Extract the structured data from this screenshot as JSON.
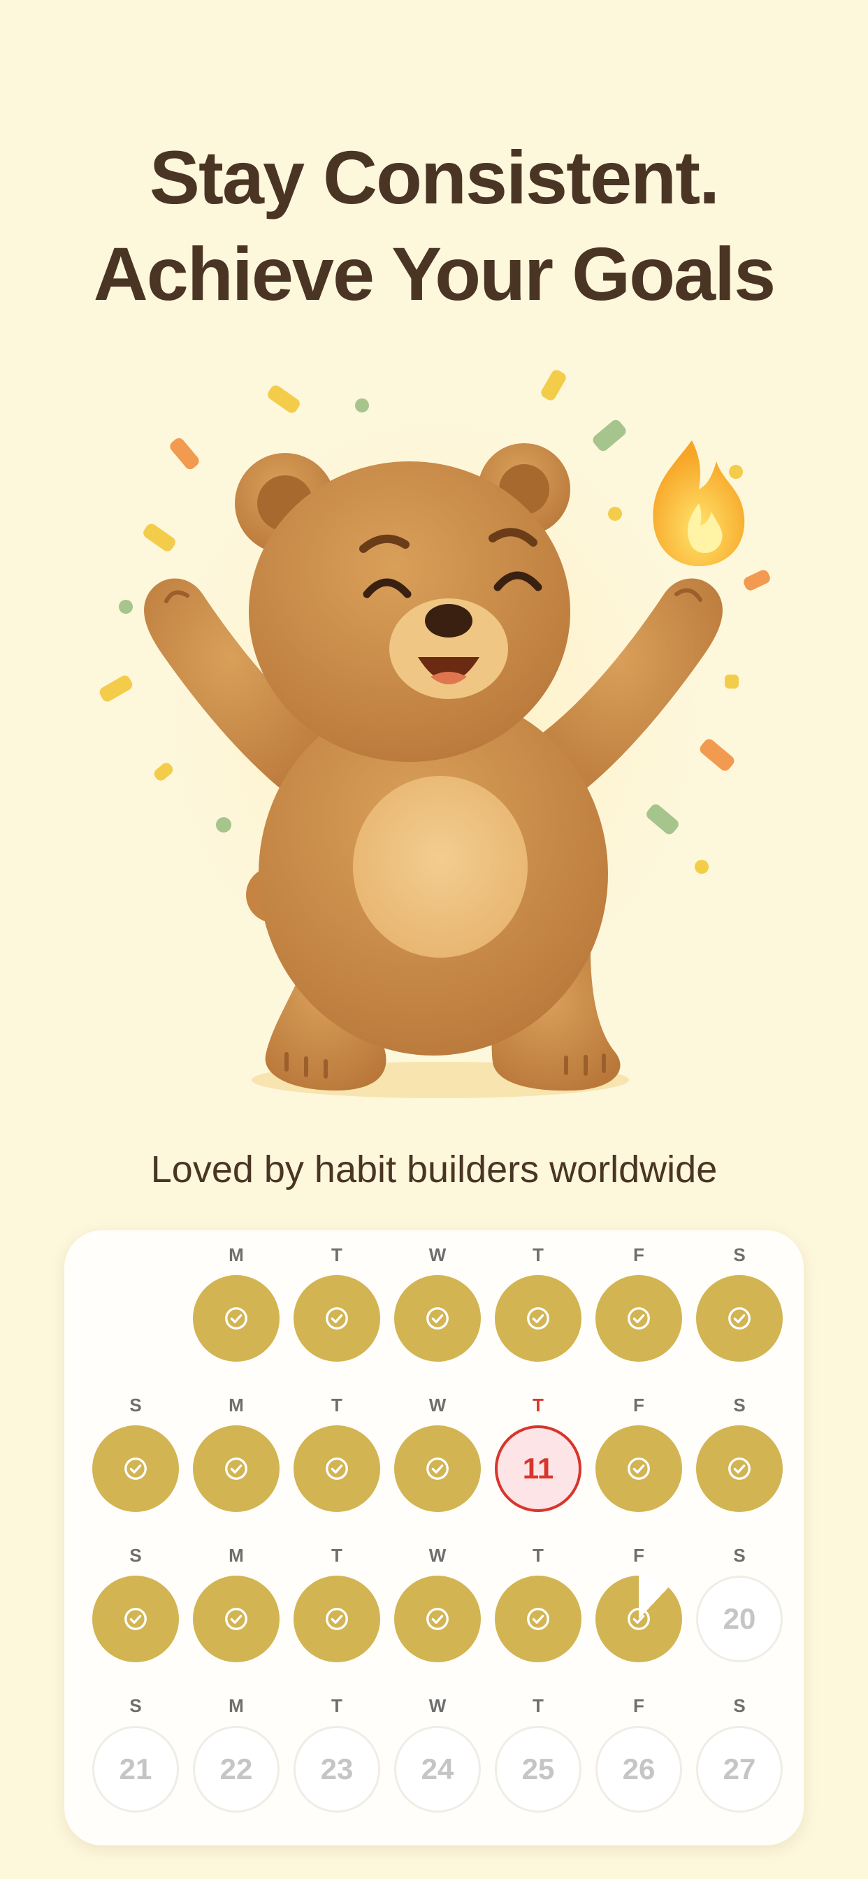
{
  "headline": {
    "line1": "Stay Consistent.",
    "line2": "Achieve Your Goals"
  },
  "hero": {
    "illustration": "dancing-bear-with-confetti-and-flame"
  },
  "tagline": "Loved by habit builders worldwide",
  "colors": {
    "background": "#fdf7dc",
    "heading": "#4a3524",
    "done": "#d2b452",
    "today_accent": "#d8352c",
    "today_fill": "#fde4e6",
    "future_text": "#c5c5c5"
  },
  "calendar": {
    "weeks": [
      {
        "days": [
          {
            "letter": "",
            "state": "empty",
            "num": ""
          },
          {
            "letter": "M",
            "state": "done",
            "num": ""
          },
          {
            "letter": "T",
            "state": "done",
            "num": ""
          },
          {
            "letter": "W",
            "state": "done",
            "num": ""
          },
          {
            "letter": "T",
            "state": "done",
            "num": ""
          },
          {
            "letter": "F",
            "state": "done",
            "num": ""
          },
          {
            "letter": "S",
            "state": "done",
            "num": ""
          }
        ]
      },
      {
        "days": [
          {
            "letter": "S",
            "state": "done",
            "num": ""
          },
          {
            "letter": "M",
            "state": "done",
            "num": ""
          },
          {
            "letter": "T",
            "state": "done",
            "num": ""
          },
          {
            "letter": "W",
            "state": "done",
            "num": ""
          },
          {
            "letter": "T",
            "state": "today",
            "num": "11"
          },
          {
            "letter": "F",
            "state": "done",
            "num": ""
          },
          {
            "letter": "S",
            "state": "done",
            "num": ""
          }
        ]
      },
      {
        "days": [
          {
            "letter": "S",
            "state": "done",
            "num": ""
          },
          {
            "letter": "M",
            "state": "done",
            "num": ""
          },
          {
            "letter": "T",
            "state": "done",
            "num": ""
          },
          {
            "letter": "W",
            "state": "done",
            "num": ""
          },
          {
            "letter": "T",
            "state": "done",
            "num": ""
          },
          {
            "letter": "F",
            "state": "partial",
            "num": ""
          },
          {
            "letter": "S",
            "state": "future",
            "num": "20"
          }
        ]
      },
      {
        "days": [
          {
            "letter": "S",
            "state": "future",
            "num": "21"
          },
          {
            "letter": "M",
            "state": "future",
            "num": "22"
          },
          {
            "letter": "T",
            "state": "future",
            "num": "23"
          },
          {
            "letter": "W",
            "state": "future",
            "num": "24"
          },
          {
            "letter": "T",
            "state": "future",
            "num": "25"
          },
          {
            "letter": "F",
            "state": "future",
            "num": "26"
          },
          {
            "letter": "S",
            "state": "future",
            "num": "27"
          }
        ]
      }
    ]
  }
}
